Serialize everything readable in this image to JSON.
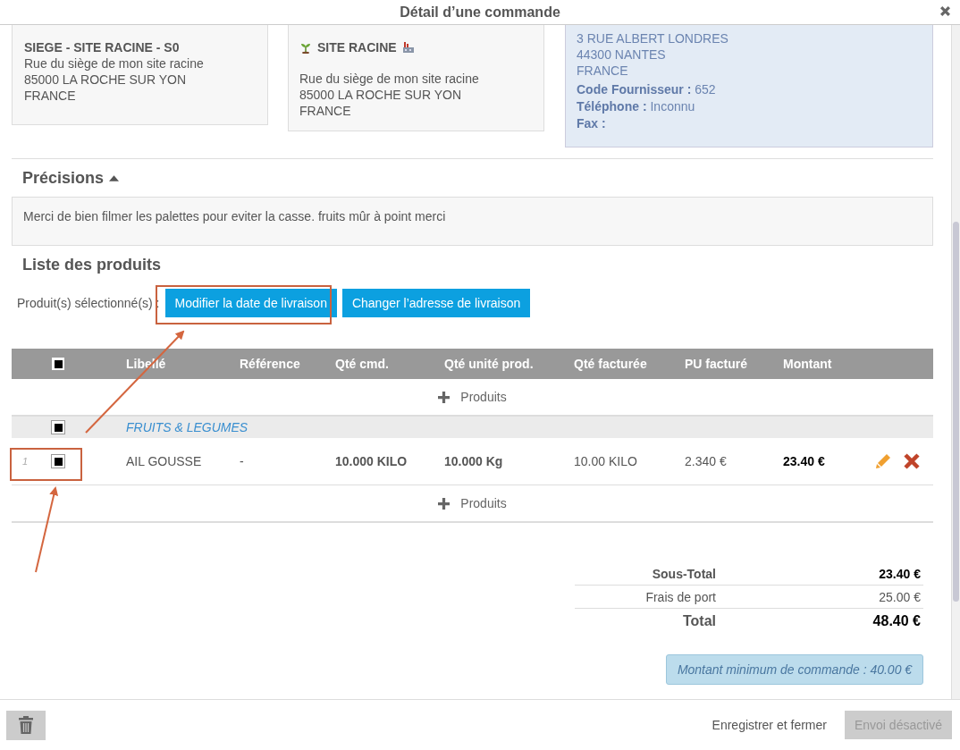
{
  "dialog": {
    "title": "Détail d’une commande"
  },
  "addresses": [
    {
      "kind": "site",
      "title": "SIEGE - SITE RACINE - S0",
      "lines": [
        "Rue du siège de mon site racine",
        "85000 LA ROCHE SUR YON",
        "FRANCE"
      ]
    },
    {
      "kind": "site_icons",
      "title": "SITE RACINE",
      "lines": [
        "Rue du siège de mon site racine",
        "85000 LA ROCHE SUR YON",
        "FRANCE"
      ]
    },
    {
      "kind": "supplier",
      "lines": [
        "3 RUE ALBERT LONDRES",
        "44300 NANTES",
        "FRANCE"
      ],
      "fields": [
        {
          "label": "Code Fournisseur :",
          "value": "652"
        },
        {
          "label": "Téléphone :",
          "value": "Inconnu"
        },
        {
          "label": "Fax :"
        }
      ]
    }
  ],
  "precisions": {
    "title": "Précisions",
    "expanded": true,
    "text": "Merci de bien filmer les palettes pour eviter la casse. fruits mûr à point merci"
  },
  "products": {
    "title": "Liste des produits",
    "selection_label": "Produit(s) sélectionné(s) :",
    "actions": [
      "Modifier la date de livraison",
      "Changer l’adresse de livraison"
    ],
    "table": {
      "header_checked": true,
      "columns": [
        "Libellé",
        "Référence",
        "Qté cmd.",
        "Qté unité prod.",
        "Qté facturée",
        "PU facturé",
        "Montant"
      ],
      "add_label": "Produits",
      "groups": [
        {
          "name": "FRUITS & LEGUMES",
          "checked": true,
          "add_label": "Produits",
          "rows": [
            {
              "number": "1",
              "checked": true,
              "cells": [
                "AIL GOUSSE",
                "-",
                "10.000 KILO",
                "10.000 Kg",
                "10.00 KILO",
                "2.340 €",
                "23.40 €"
              ]
            }
          ]
        }
      ]
    }
  },
  "totals": [
    {
      "kind": "subtotal",
      "label": "Sous-Total",
      "value": "23.40 €"
    },
    {
      "kind": "shipping",
      "label": "Frais de port",
      "value": "25.00 €"
    },
    {
      "kind": "total",
      "label": "Total",
      "value": "48.40 €"
    }
  ],
  "notice": "Montant minimum de commande : 40.00 €",
  "footer": {
    "save_label": "Enregistrer et fermer",
    "send": {
      "label": "Envoi désactivé",
      "disabled": true
    }
  }
}
